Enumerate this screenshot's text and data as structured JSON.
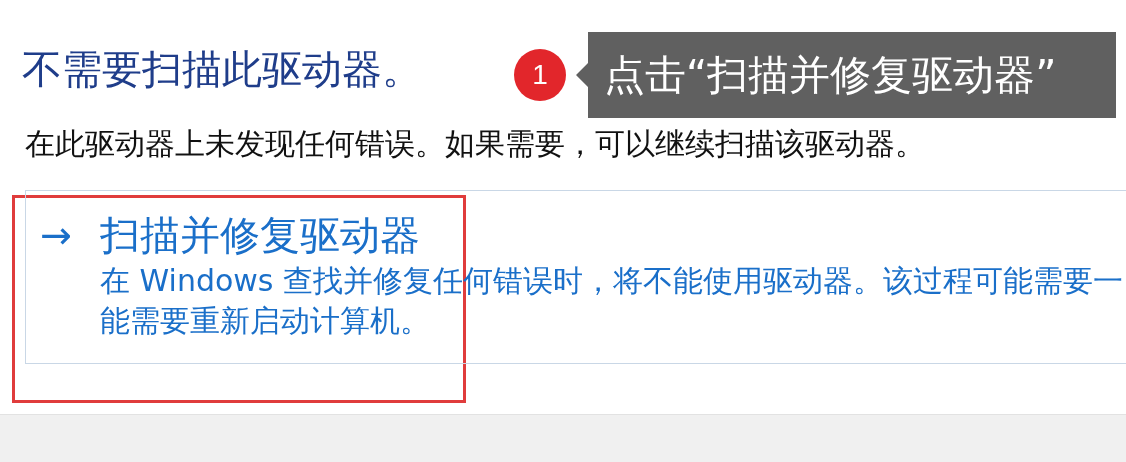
{
  "heading": "不需要扫描此驱动器。",
  "message": "在此驱动器上未发现任何错误。如果需要，可以继续扫描该驱动器。",
  "annotation": {
    "number": "1",
    "text": "点击“扫描并修复驱动器”"
  },
  "action": {
    "icon": "→",
    "title": "扫描并修复驱动器",
    "highlighted": true,
    "description_lines": [
      "在 Windows 查找并修复任何错误时，将不能使用驱动器。该过程可能需要一",
      "能需要重新启动计算机。"
    ]
  }
}
